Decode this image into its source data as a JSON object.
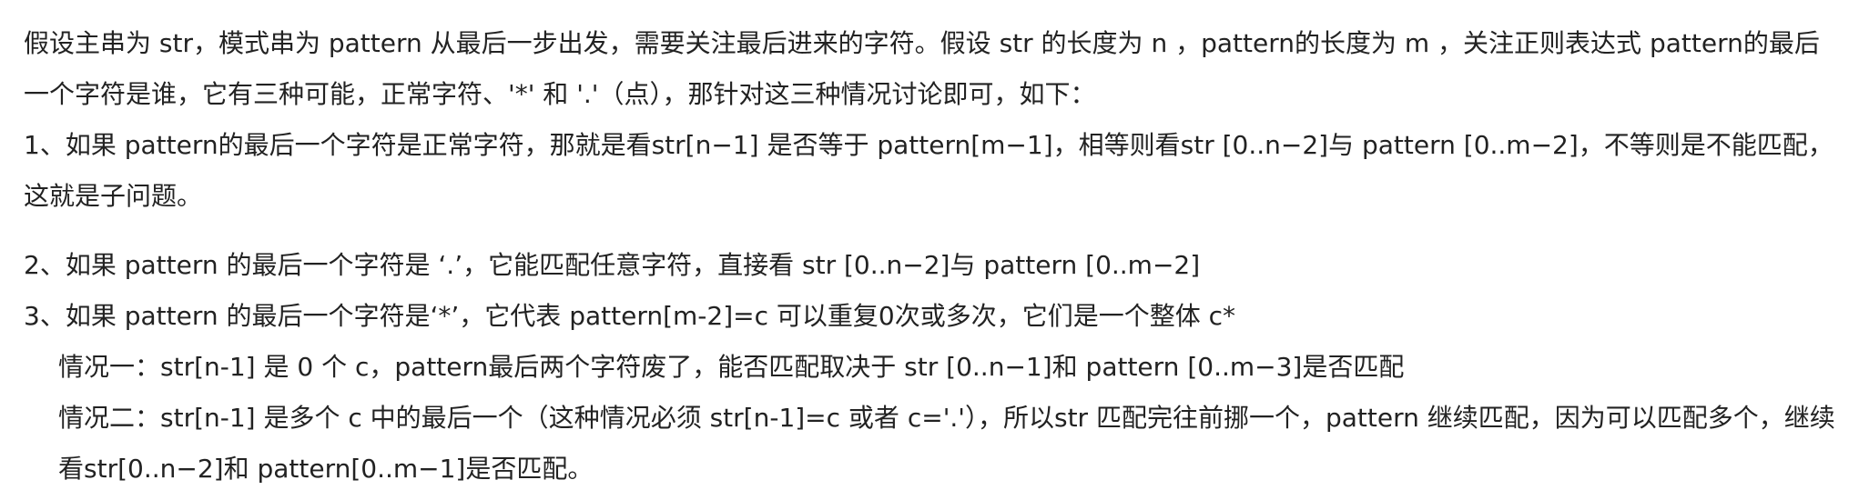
{
  "document": {
    "paragraphs": [
      "假设主串为 str，模式串为 pattern 从最后一步出发，需要关注最后进来的字符。假设 str 的长度为 n ，pattern的长度为 m ，关注正则表达式 pattern的最后一个字符是谁，它有三种可能，正常字符、'*' 和 '.'（点），那针对这三种情况讨论即可，如下：",
      "1、如果 pattern的最后一个字符是正常字符，那就是看str[n−1] 是否等于 pattern[m−1]，相等则看str [0..n−2]与 pattern [0..m−2]，不等则是不能匹配，这就是子问题。",
      "2、如果 pattern 的最后一个字符是 ‘.’，它能匹配任意字符，直接看 str [0..n−2]与 pattern [0..m−2]",
      "3、如果 pattern 的最后一个字符是‘*’，它代表 pattern[m-2]=c 可以重复0次或多次，它们是一个整体 c*",
      "情况一：str[n-1] 是 0 个 c，pattern最后两个字符废了，能否匹配取决于 str [0..n−1]和 pattern [0..m−3]是否匹配",
      "情况二：str[n-1] 是多个 c 中的最后一个（这种情况必须 str[n-1]=c 或者 c='.'），所以str 匹配完往前挪一个，pattern  继续匹配，因为可以匹配多个，继续看str[0..n−2]和 pattern[0..m−1]是否匹配。"
    ]
  }
}
